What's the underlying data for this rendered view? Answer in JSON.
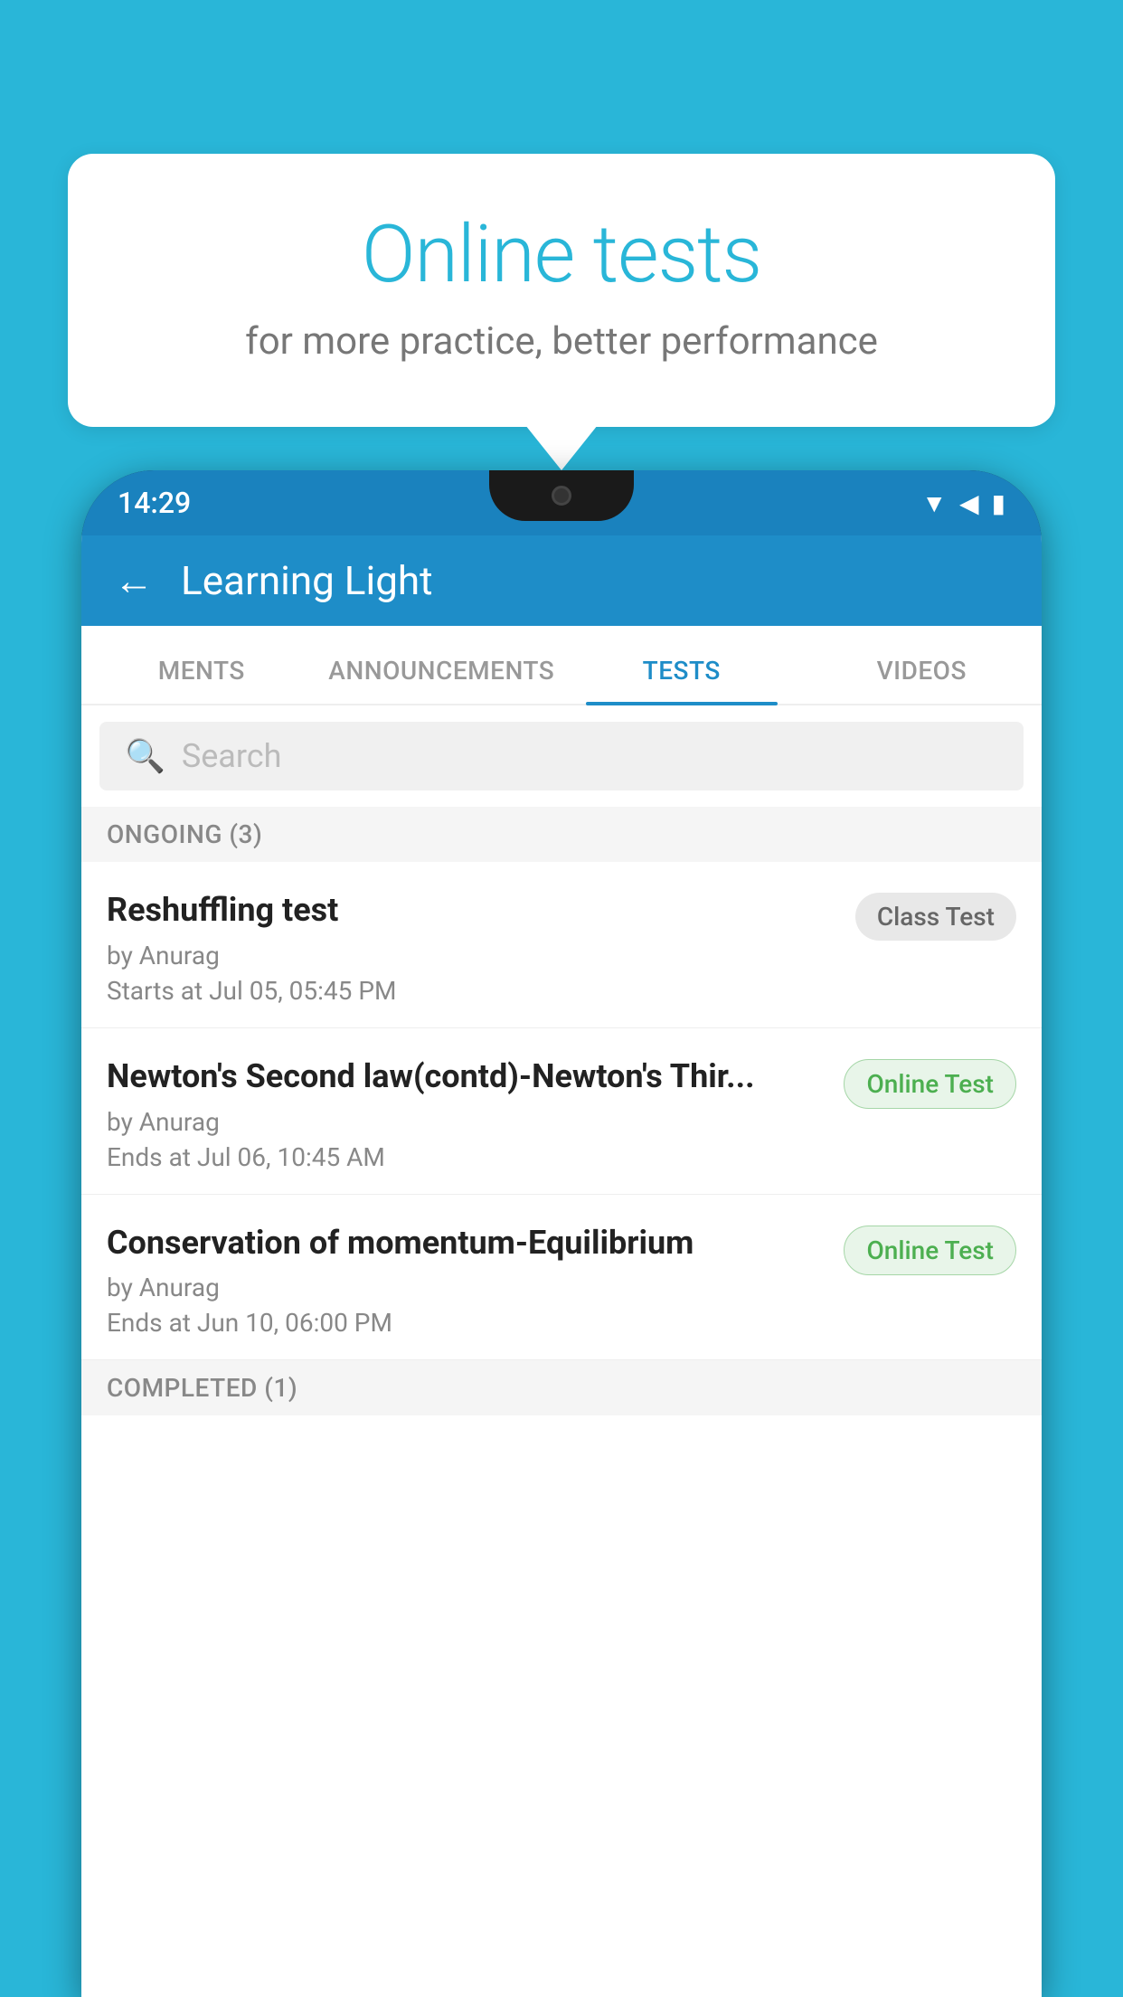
{
  "background": {
    "color": "#29b6d8"
  },
  "bubble": {
    "title": "Online tests",
    "subtitle": "for more practice, better performance"
  },
  "phone": {
    "status_bar": {
      "time": "14:29",
      "icons": [
        "▼",
        "◀",
        "▮"
      ]
    },
    "header": {
      "back_label": "←",
      "title": "Learning Light"
    },
    "tabs": [
      {
        "label": "MENTS",
        "active": false
      },
      {
        "label": "ANNOUNCEMENTS",
        "active": false
      },
      {
        "label": "TESTS",
        "active": true
      },
      {
        "label": "VIDEOS",
        "active": false
      }
    ],
    "search": {
      "placeholder": "Search"
    },
    "sections": [
      {
        "header": "ONGOING (3)",
        "items": [
          {
            "name": "Reshuffling test",
            "author": "by Anurag",
            "time": "Starts at  Jul 05, 05:45 PM",
            "badge": "Class Test",
            "badge_type": "class"
          },
          {
            "name": "Newton's Second law(contd)-Newton's Thir...",
            "author": "by Anurag",
            "time": "Ends at  Jul 06, 10:45 AM",
            "badge": "Online Test",
            "badge_type": "online"
          },
          {
            "name": "Conservation of momentum-Equilibrium",
            "author": "by Anurag",
            "time": "Ends at  Jun 10, 06:00 PM",
            "badge": "Online Test",
            "badge_type": "online"
          }
        ]
      },
      {
        "header": "COMPLETED (1)",
        "items": []
      }
    ]
  }
}
